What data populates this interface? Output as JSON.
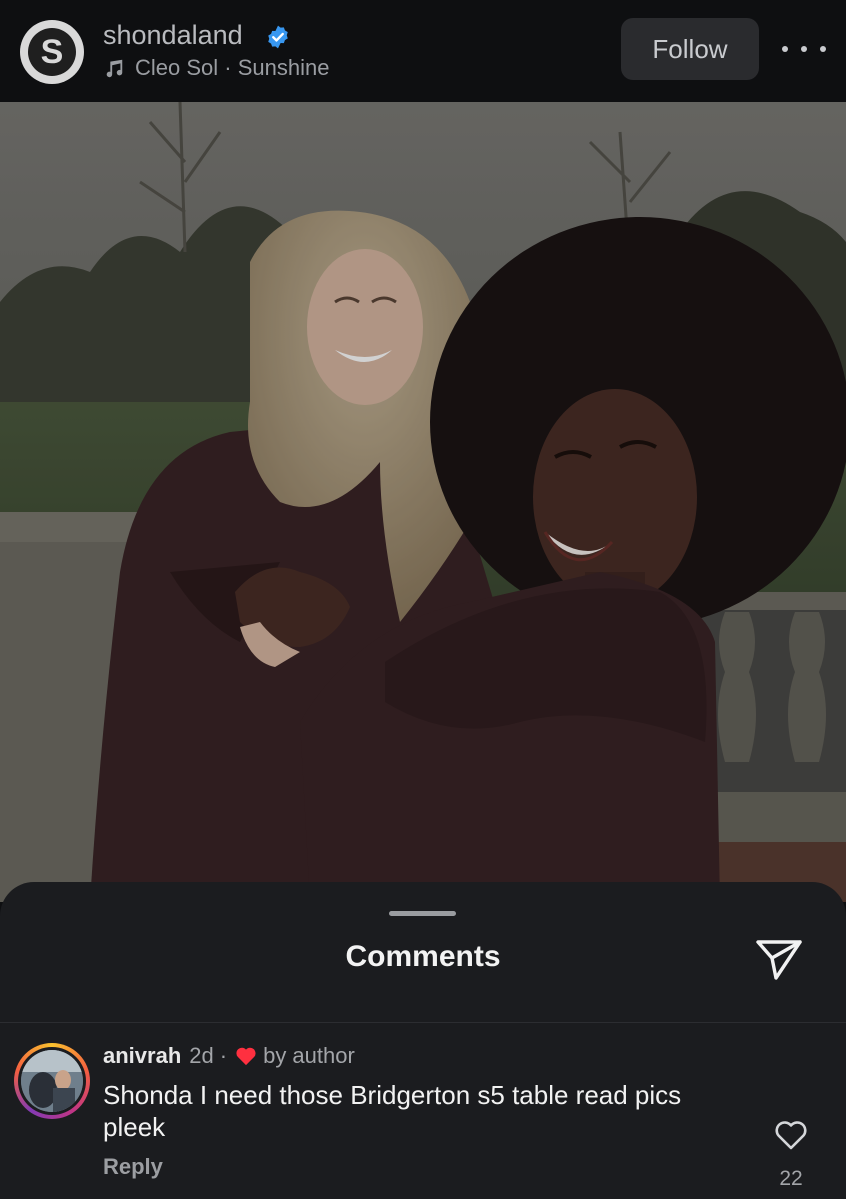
{
  "header": {
    "account_initial": "S",
    "username": "shondaland",
    "audio": "Cleo Sol · Sunshine",
    "follow_label": "Follow",
    "icons": {
      "verified": "verified-badge-icon",
      "music": "music-note-icon",
      "more": "more-horizontal-icon"
    },
    "colors": {
      "verified": "#3897f0"
    }
  },
  "sheet": {
    "title": "Comments",
    "share_icon": "send-icon"
  },
  "comments": [
    {
      "username": "anivrah",
      "time": "2d",
      "separator": "·",
      "badge": "by author",
      "text": "Shonda I need those Bridgerton s5 table read pics pleek",
      "reply_label": "Reply",
      "likes": "22",
      "icons": {
        "liked_by_author": "red-heart-icon",
        "like": "heart-outline-icon"
      },
      "colors": {
        "author_heart": "#ff3040"
      }
    }
  ]
}
